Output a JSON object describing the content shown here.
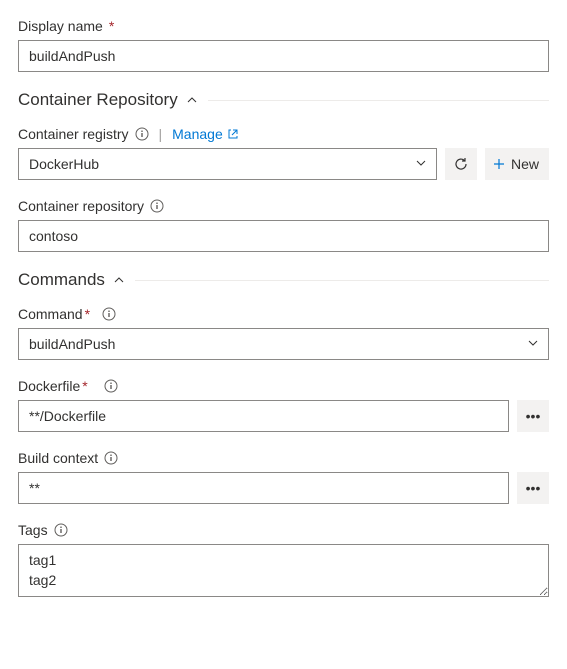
{
  "displayName": {
    "label": "Display name",
    "value": "buildAndPush"
  },
  "sections": {
    "containerRepository": {
      "title": "Container Repository"
    },
    "commands": {
      "title": "Commands"
    }
  },
  "containerRegistry": {
    "label": "Container registry",
    "manageLink": "Manage",
    "selected": "DockerHub",
    "newButton": "New"
  },
  "containerRepository": {
    "label": "Container repository",
    "value": "contoso"
  },
  "command": {
    "label": "Command",
    "selected": "buildAndPush"
  },
  "dockerfile": {
    "label": "Dockerfile",
    "value": "**/Dockerfile"
  },
  "buildContext": {
    "label": "Build context",
    "value": "**"
  },
  "tags": {
    "label": "Tags",
    "value": "tag1\ntag2"
  }
}
